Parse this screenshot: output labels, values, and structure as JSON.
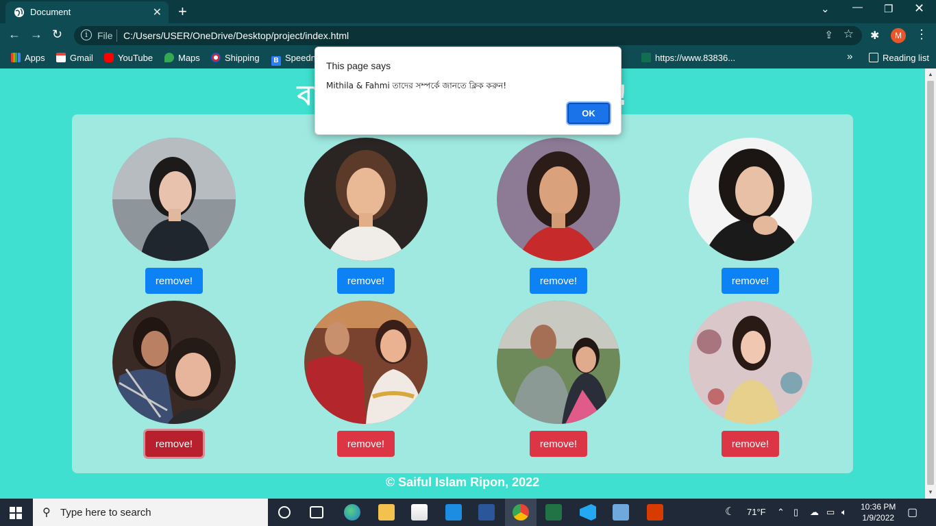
{
  "browser": {
    "tab_title": "Document",
    "url_scheme": "File",
    "url": "C:/Users/USER/OneDrive/Desktop/project/index.html",
    "profile_initial": "M",
    "bookmarks": [
      "Apps",
      "Gmail",
      "YouTube",
      "Maps",
      "Shipping",
      "Speedn",
      "https://www.83836..."
    ],
    "reading_list": "Reading list"
  },
  "page": {
    "heading": "বারোভাতারি ক  বর করে দিন !",
    "cards": [
      {
        "button": "remove!",
        "variant": "blue"
      },
      {
        "button": "remove!",
        "variant": "blue"
      },
      {
        "button": "remove!",
        "variant": "blue"
      },
      {
        "button": "remove!",
        "variant": "blue"
      },
      {
        "button": "remove!",
        "variant": "red"
      },
      {
        "button": "remove!",
        "variant": "red"
      },
      {
        "button": "remove!",
        "variant": "red"
      },
      {
        "button": "remove!",
        "variant": "red"
      }
    ],
    "footer": "© Saiful Islam Ripon, 2022"
  },
  "dialog": {
    "title": "This page says",
    "message": "Mithila & Fahmi তাদের সম্পর্কে জানতে ক্লিক করুন!",
    "ok": "OK"
  },
  "taskbar": {
    "search_placeholder": "Type here to search",
    "weather": "71°F",
    "time": "10:36 PM",
    "date": "1/9/2022"
  },
  "colors": {
    "page_bg": "#3fe0d0",
    "panel_bg": "#9fe9e1",
    "blue_button": "#0d82f4",
    "red_button": "#dc3545"
  }
}
